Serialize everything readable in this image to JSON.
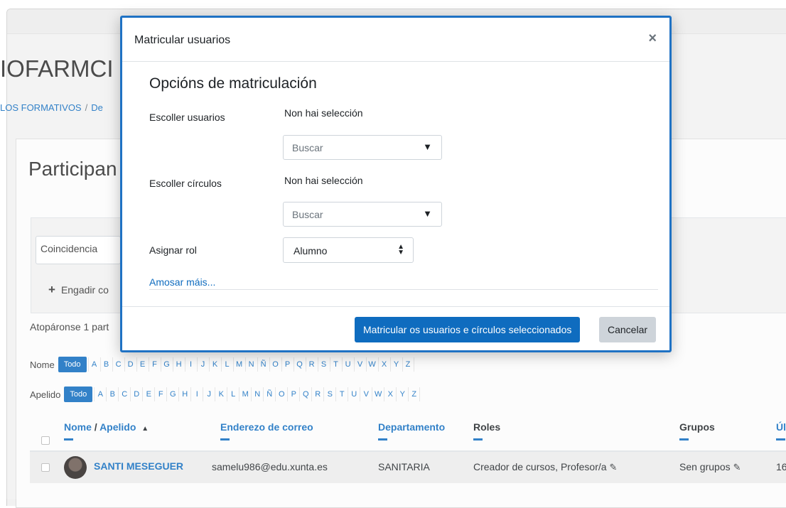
{
  "page": {
    "course_title": "IOFARMCI",
    "breadcrumb": {
      "item1": "LOS FORMATIVOS",
      "sep": "/",
      "item2": "De"
    },
    "heading": "Participan",
    "filter": {
      "match_label": "Coincidencia",
      "add_condition": "Engadir co"
    },
    "found_text": "Atopáronse 1 part"
  },
  "letter_filters": {
    "first_name": {
      "label": "Nome",
      "all": "Todo"
    },
    "last_name": {
      "label": "Apelido",
      "all": "Todo"
    },
    "letters": [
      "A",
      "B",
      "C",
      "D",
      "E",
      "F",
      "G",
      "H",
      "I",
      "J",
      "K",
      "L",
      "M",
      "N",
      "Ñ",
      "O",
      "P",
      "Q",
      "R",
      "S",
      "T",
      "U",
      "V",
      "W",
      "X",
      "Y",
      "Z"
    ]
  },
  "table": {
    "headers": {
      "name": "Nome",
      "slash": " / ",
      "surname": "Apelido",
      "sort_icon": "▲",
      "email": "Enderezo de correo",
      "department": "Departamento",
      "roles": "Roles",
      "groups": "Grupos",
      "last": "Úl"
    },
    "rows": [
      {
        "name": "SANTI MESEGUER",
        "email": "samelu986@edu.xunta.es",
        "department": "SANITARIA",
        "roles": "Creador de cursos, Profesor/a",
        "groups": "Sen grupos",
        "last": "16"
      }
    ]
  },
  "modal": {
    "title": "Matricular usuarios",
    "close": "×",
    "section_title": "Opcións de matriculación",
    "select_users": {
      "label": "Escoller usuarios",
      "selection": "Non hai selección",
      "placeholder": "Buscar"
    },
    "select_cohorts": {
      "label": "Escoller círculos",
      "selection": "Non hai selección",
      "placeholder": "Buscar"
    },
    "assign_role": {
      "label": "Asignar rol",
      "value": "Alumno"
    },
    "show_more": "Amosar máis...",
    "enrol_button": "Matricular os usuarios e círculos seleccionados",
    "cancel_button": "Cancelar"
  },
  "icons": {
    "close": "close-icon",
    "dropdown": "caret-down-icon",
    "updown": "updown-icon",
    "plus": "plus-icon",
    "pencil": "pencil-icon",
    "sort": "sort-asc-icon"
  },
  "colors": {
    "primary": "#0f6cbf",
    "modal_border": "#1f72c4",
    "secondary_button": "#ced4da"
  }
}
